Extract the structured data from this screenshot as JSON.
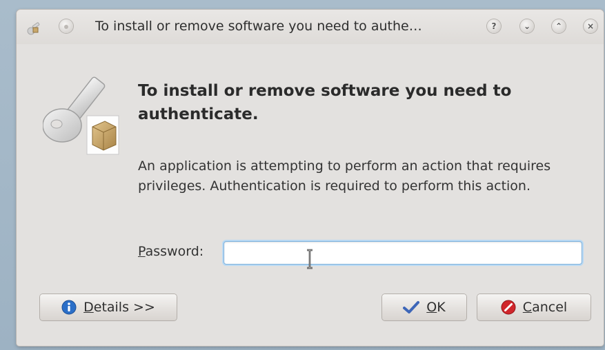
{
  "window": {
    "title": "To install or remove software you need to authe…"
  },
  "titlebar_buttons": {
    "help": "?",
    "minimize": "⌄",
    "maximize": "⌃",
    "close": "×"
  },
  "dialog": {
    "heading": "To install or remove software you need to authenticate.",
    "description": "An application is attempting to perform an action that requires privileges. Authentication is required to perform this action.",
    "password_label_mnemonic": "P",
    "password_label_rest": "assword:",
    "password_value": ""
  },
  "buttons": {
    "details_mnemonic": "D",
    "details_rest": "etails >>",
    "ok_mnemonic": "O",
    "ok_rest": "K",
    "cancel_mnemonic": "C",
    "cancel_rest": "ancel"
  },
  "icons": {
    "app": "key-package-icon",
    "details": "info-icon",
    "ok": "checkmark-icon",
    "cancel": "no-entry-icon"
  },
  "colors": {
    "info": "#2b6fc8",
    "ok": "#3d66b8",
    "cancel": "#d0262b",
    "input_focus": "#7fb2dd"
  }
}
